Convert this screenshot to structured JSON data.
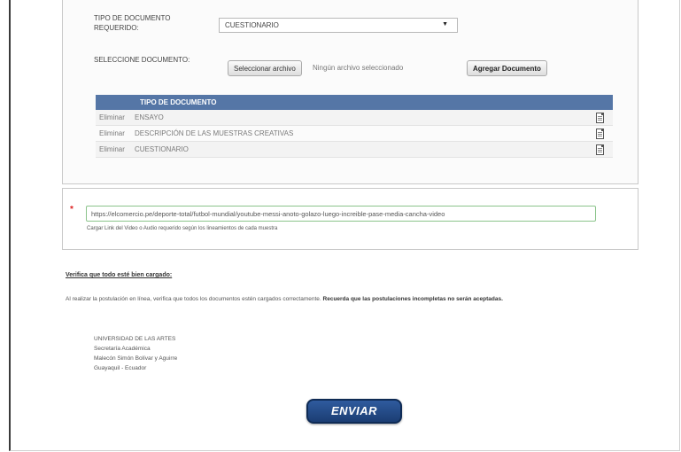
{
  "form": {
    "tipo_label": "TIPO DE DOCUMENTO REQUERIDO:",
    "tipo_value": "CUESTIONARIO",
    "select_label": "SELECCIONE DOCUMENTO:",
    "select_file_button": "Seleccionar archivo",
    "no_file_text": "Ningún archivo seleccionado",
    "add_document_button": "Agregar Documento"
  },
  "table": {
    "header": "TIPO DE DOCUMENTO",
    "rows": [
      {
        "action": "Eliminar",
        "name": "ENSAYO"
      },
      {
        "action": "Eliminar",
        "name": "DESCRIPCIÓN DE LAS MUESTRAS CREATIVAS"
      },
      {
        "action": "Eliminar",
        "name": "CUESTIONARIO"
      }
    ]
  },
  "url": {
    "required_mark": "*",
    "value": "https://elcomercio.pe/deporte-total/futbol-mundial/youtube-messi-anoto-golazo-luego-increible-pase-media-cancha-video",
    "hint": "Cargar Link del Video o Audio requerido según los lineamientos de cada muestra"
  },
  "verify": {
    "link": "Verifica que todo esté bien cargado:",
    "text": "Al realizar la postulación en línea, verifica que todos los documentos estén cargados correctamente.",
    "text_bold": "Recuerda que las postulaciones incompletas no serán aceptadas."
  },
  "address": {
    "line1": "UNIVERSIDAD DE LAS ARTES",
    "line2": "Secretaría Académica",
    "line3": "Malecón Simón Bolívar y Aguirre",
    "line4": "Guayaquil - Ecuador"
  },
  "submit": {
    "label": "ENVIAR"
  }
}
